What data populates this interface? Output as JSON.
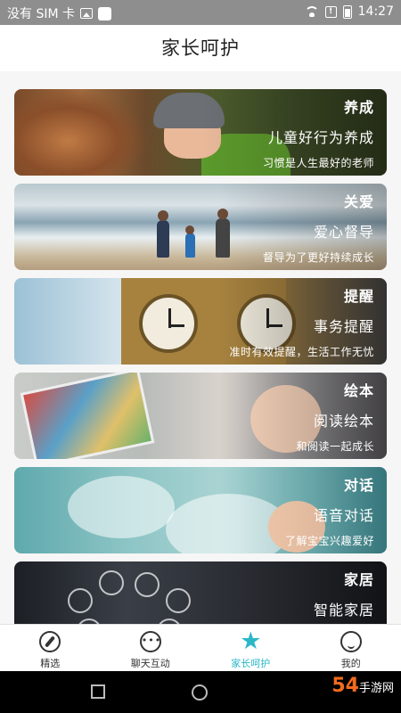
{
  "status_bar": {
    "carrier": "没有 SIM 卡",
    "time": "14:27",
    "icons": [
      "image-icon",
      "notification-square-icon",
      "wifi-icon",
      "alert-icon",
      "battery-icon"
    ]
  },
  "header": {
    "title": "家长呵护"
  },
  "cards": [
    {
      "tag": "养成",
      "title": "儿童好行为养成",
      "subtitle": "习惯是人生最好的老师"
    },
    {
      "tag": "关爱",
      "title": "爱心督导",
      "subtitle": "督导为了更好持续成长"
    },
    {
      "tag": "提醒",
      "title": "事务提醒",
      "subtitle": "准时有效提醒，生活工作无忧"
    },
    {
      "tag": "绘本",
      "title": "阅读绘本",
      "subtitle": "和阅读一起成长"
    },
    {
      "tag": "对话",
      "title": "语音对话",
      "subtitle": "了解宝宝兴趣爱好"
    },
    {
      "tag": "家居",
      "title": "智能家居",
      "subtitle": ""
    }
  ],
  "tabs": [
    {
      "label": "精选",
      "icon": "compass-icon",
      "active": false
    },
    {
      "label": "聊天互动",
      "icon": "chat-icon",
      "active": false
    },
    {
      "label": "家长呵护",
      "icon": "star-icon",
      "active": true
    },
    {
      "label": "我的",
      "icon": "face-icon",
      "active": false
    }
  ],
  "colors": {
    "accent": "#2ab7c8",
    "status_bar": "#8e8e8e"
  },
  "watermark": {
    "brand": "54",
    "small": "手游网"
  }
}
